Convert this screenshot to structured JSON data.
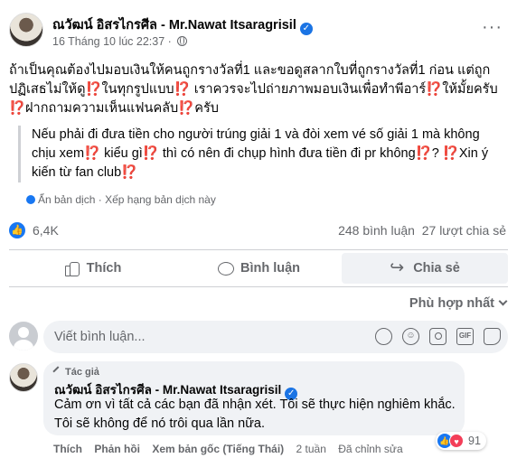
{
  "post": {
    "author": "ณวัฒน์ อิสรไกรศีล - Mr.Nawat Itsaragrisil",
    "timestamp": "16 Tháng 10 lúc 22:37",
    "separator": "·",
    "text": "ถ้าเป็นคุณต้องไปมอบเงินให้คนถูกรางวัลที่1 และขอดูสลากใบที่ถูกรางวัลที่1 ก่อน แต่ถูกปฏิเสธไม่ให้ดู⁉️ในทุกรูปแบบ⁉️ เราควรจะไปถ่ายภาพมอบเงินเพื่อทำพีอาร์⁉️ให้มั้ยครับ ⁉️ฝากถามความเห็นแฟนคลับ⁉️ครับ",
    "translation": "Nếu phải đi đưa tiền cho người trúng giải 1 và đòi xem vé số giải 1 mà không chịu xem⁉️ kiểu gì⁉️ thì có nên đi chụp hình đưa tiền đi pr không⁉️? ⁉️Xin ý kiến từ fan club⁉️",
    "hide_translation": "Ẩn bản dịch",
    "rate_translation": "Xếp hạng bản dịch này"
  },
  "stats": {
    "reactions": "6,4K",
    "comments": "248 bình luận",
    "shares": "27 lượt chia sẻ"
  },
  "actions": {
    "like": "Thích",
    "comment": "Bình luận",
    "share": "Chia sẻ"
  },
  "sort": {
    "label": "Phù hợp nhất"
  },
  "composer": {
    "placeholder": "Viết bình luận..."
  },
  "reply": {
    "author_tag": "Tác giả",
    "author": "ณวัฒน์ อิสรไกรศีล - Mr.Nawat Itsaragrisil",
    "text": "Cảm ơn vì tất cả các bạn đã nhận xét. Tôi sẽ thực hiện nghiêm khắc. Tôi sẽ không để nó trôi qua lần nữa.",
    "like": "Thích",
    "reply": "Phản hồi",
    "see_original": "Xem bản gốc (Tiếng Thái)",
    "time": "2 tuần",
    "edited": "Đã chỉnh sửa",
    "reaction_count": "91"
  },
  "icons": {
    "verified": "verified-badge-icon",
    "globe": "globe-icon",
    "more": "more-icon",
    "like": "thumbs-up-icon",
    "comment": "comment-icon",
    "share": "share-icon",
    "sticker": "sticker-icon",
    "emoji": "emoji-icon",
    "camera": "camera-icon",
    "gif": "gif-icon",
    "love": "heart-icon"
  },
  "colors": {
    "accent": "#1877f2",
    "love": "#f33e58",
    "muted": "#65676b",
    "bubble": "#f0f2f5"
  }
}
